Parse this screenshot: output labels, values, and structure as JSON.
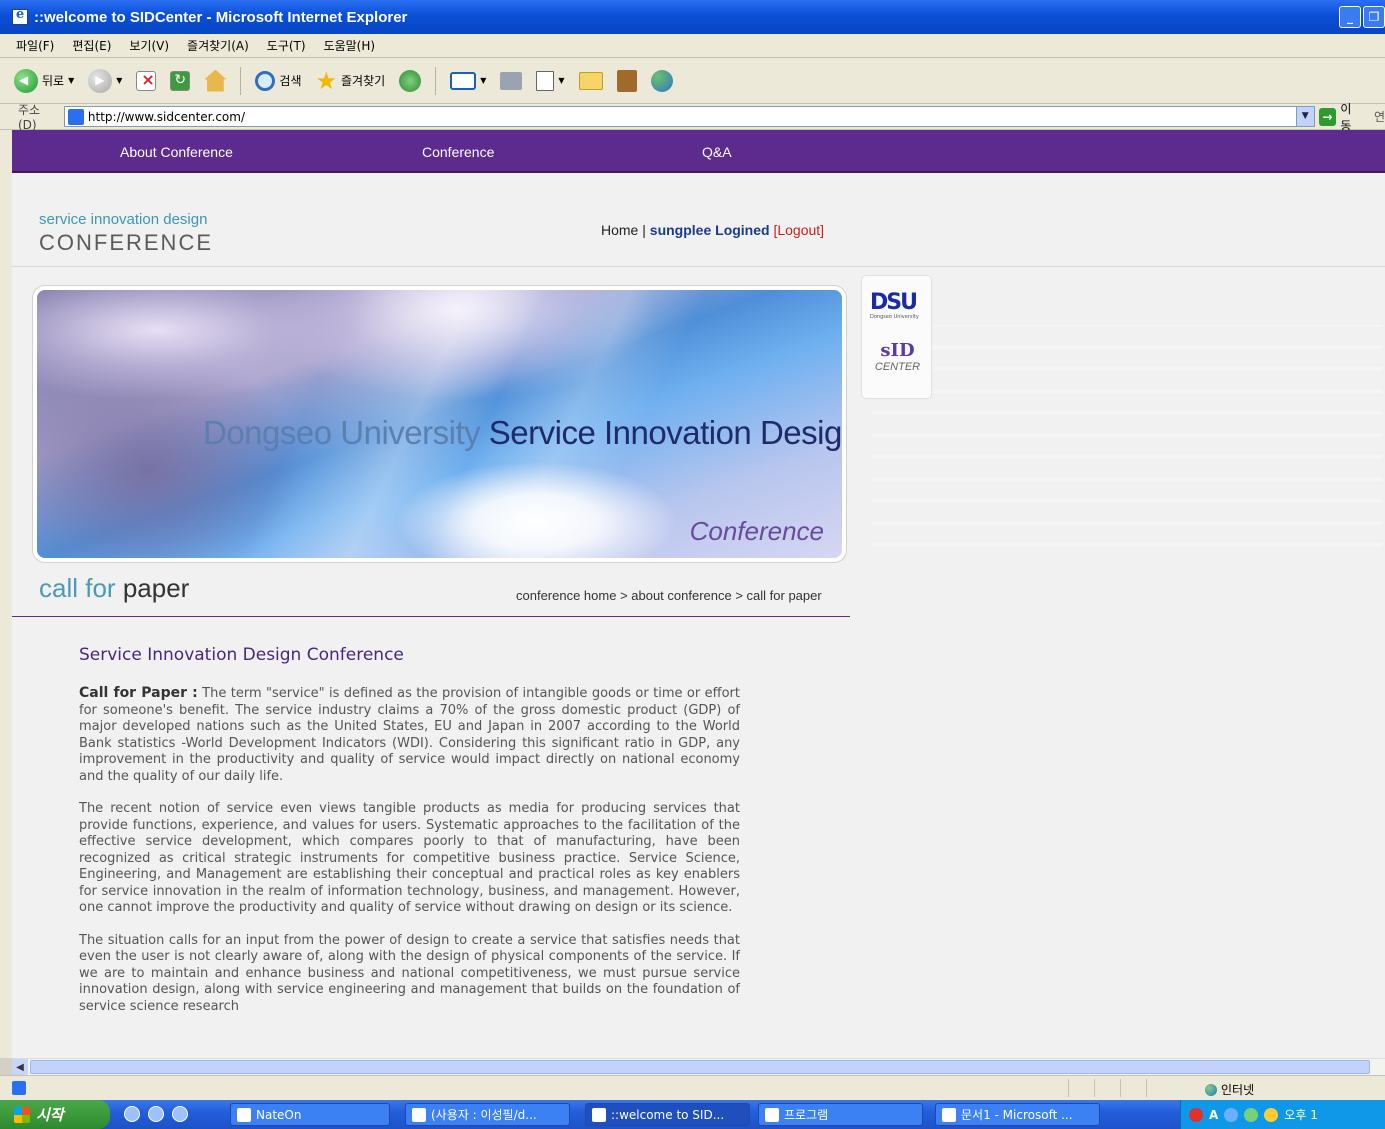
{
  "window": {
    "title": "::welcome to SIDCenter - Microsoft Internet Explorer",
    "buttons": [
      "_",
      "❐"
    ]
  },
  "menubar": [
    "파일(F)",
    "편집(E)",
    "보기(V)",
    "즐겨찾기(A)",
    "도구(T)",
    "도움말(H)"
  ],
  "toolbar": {
    "back_label": "뒤로",
    "search_label": "검색",
    "favorites_label": "즐겨찾기"
  },
  "addressbar": {
    "label": "주소(D)",
    "url": "http://www.sidcenter.com/",
    "go_label": "이동",
    "links_label": "연"
  },
  "page": {
    "nav": [
      "About Conference",
      "Conference",
      "Q&A"
    ],
    "logo": {
      "sub": "service innovation design",
      "main": "CONFERENCE"
    },
    "user": {
      "home": "Home",
      "sep": "|",
      "username": "sungplee",
      "logined": "Logined",
      "logout": "[Logout]"
    },
    "banner": {
      "title_light": "Dongseo University",
      "title_dark": "Service Innovation Design",
      "subtitle": "Conference"
    },
    "partners": {
      "dsu_text": "DSU",
      "dsu_small": "Dongseo University",
      "sid_text": "sID",
      "sid_label": "CENTER"
    },
    "section": {
      "title_light": "call for",
      "title_dark": "paper"
    },
    "breadcrumb": "conference home > about conference > call for paper",
    "content": {
      "heading": "Service Innovation Design Conference",
      "lead_label": "Call for Paper :",
      "p1": "The term \"service\" is defined as the provision of intangible goods or time or effort for someone's benefit. The service industry claims a 70% of the gross domestic product (GDP) of major developed nations such as the United States, EU and Japan in 2007 according to the World Bank statistics -World Development Indicators (WDI). Considering this significant ratio in GDP, any improvement in the productivity and quality of service would impact directly on national economy and the quality of our daily life.",
      "p2": "The recent notion of service even views tangible products as media for producing services that provide functions, experience, and values for users. Systematic approaches to the facilitation of the effective service development, which compares poorly to that of manufacturing, have been recognized as critical strategic instruments for competitive business practice. Service Science, Engineering, and Management are establishing their conceptual and practical roles as key enablers for service innovation in the realm of information technology, business, and management. However, one cannot improve the productivity and quality of service without drawing on design or its science.",
      "p3": "The situation calls for an input from the power of design to create a service that satisfies needs that even the user is not clearly aware of, along with the design of physical components of the service. If we are to maintain and enhance business and national competitiveness, we must pursue service innovation design, along with service engineering and management that builds on the foundation of service science research"
    }
  },
  "statusbar": {
    "zone": "인터넷"
  },
  "taskbar": {
    "start": "시작",
    "tasks": [
      "NateOn",
      "(사용자 : 이성필/d...",
      "::welcome to SID...",
      "프로그램",
      "문서1 - Microsoft ..."
    ],
    "clock": "오후 1"
  }
}
